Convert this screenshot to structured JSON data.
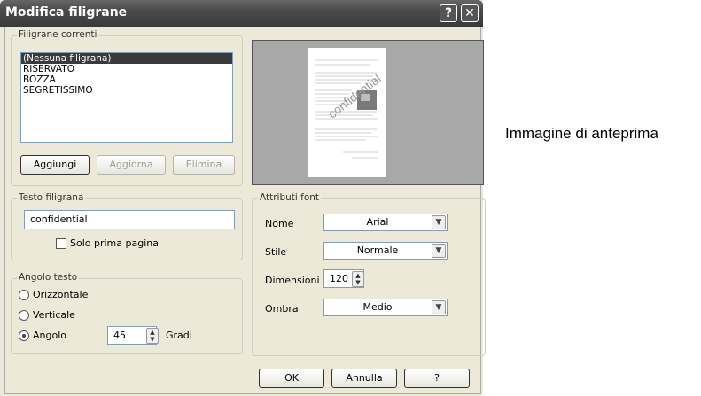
{
  "window": {
    "title": "Modifica filigrane",
    "help_glyph": "?",
    "close_glyph": "✕"
  },
  "current_watermarks": {
    "legend": "Filigrane correnti",
    "items": [
      "(Nessuna filigrana)",
      "RISERVATO",
      "BOZZA",
      "SEGRETISSIMO"
    ],
    "selected_index": 0,
    "add_label": "Aggiungi",
    "update_label": "Aggiorna",
    "delete_label": "Elimina"
  },
  "watermark_text": {
    "legend": "Testo filigrana",
    "value": "confidential",
    "first_page_only_label": "Solo prima pagina",
    "first_page_only_checked": false
  },
  "text_angle": {
    "legend": "Angolo testo",
    "horizontal_label": "Orizzontale",
    "vertical_label": "Verticale",
    "angle_label": "Angolo",
    "selected": "angle",
    "angle_value": "45",
    "degrees_label": "Gradi"
  },
  "font_attributes": {
    "legend": "Attributi font",
    "name_label": "Nome",
    "name_value": "Arial",
    "style_label": "Stile",
    "style_value": "Normale",
    "size_label": "Dimensioni",
    "size_value": "120",
    "shadow_label": "Ombra",
    "shadow_value": "Medio"
  },
  "preview": {
    "watermark_text": "confidential",
    "callout": "Immagine di anteprima"
  },
  "footer": {
    "ok_label": "OK",
    "cancel_label": "Annulla",
    "help_label": "?"
  },
  "icons": [
    "help-icon",
    "close-icon",
    "spin-up-icon",
    "spin-down-icon",
    "dropdown-arrow-icon"
  ],
  "colors": {
    "titlebar": "#4a4a4a",
    "dialog_bg": "#ece9d8",
    "selection": "#3a3a3a",
    "preview_bg": "#a8a8a8"
  }
}
